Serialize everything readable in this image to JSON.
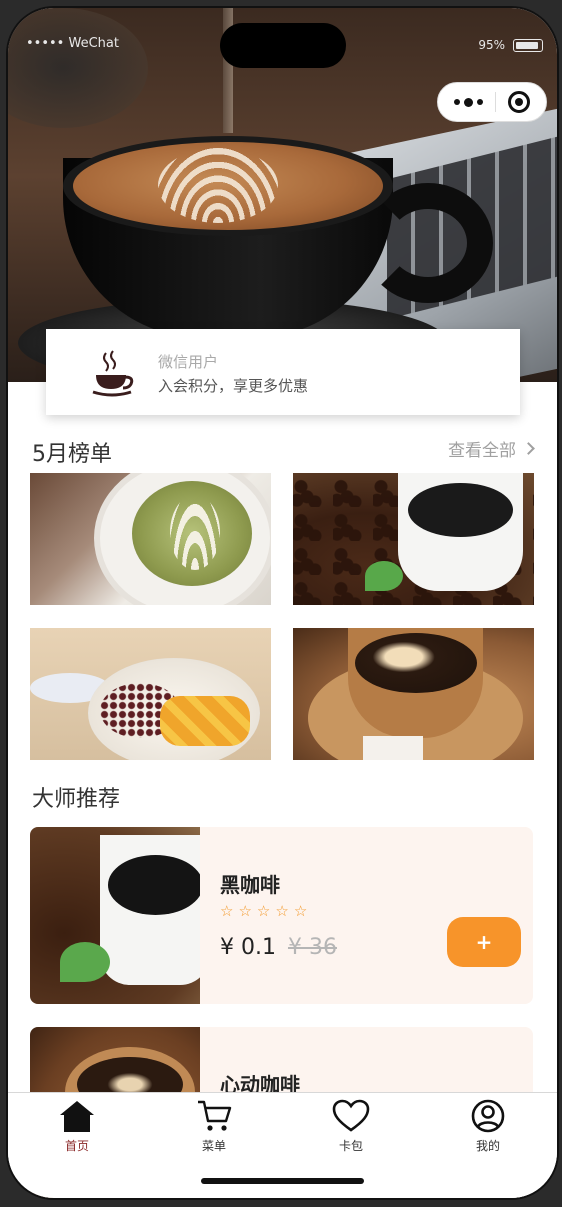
{
  "status_bar": {
    "carrier": "••••• WeChat",
    "battery": "95%"
  },
  "member": {
    "name": "微信用户",
    "desc": "入会积分，享更多优惠"
  },
  "ranking": {
    "title": "5月榜单",
    "see_all": "查看全部"
  },
  "recommend": {
    "title": "大师推荐",
    "items": [
      {
        "name": "黑咖啡",
        "price": "¥ 0.1",
        "old_price": "¥ 36",
        "add": "+",
        "rating": 0
      },
      {
        "name": "心动咖啡"
      }
    ]
  },
  "tabs": [
    {
      "label": "首页",
      "icon": "home-icon",
      "active": true
    },
    {
      "label": "菜单",
      "icon": "cart-icon"
    },
    {
      "label": "卡包",
      "icon": "heart-icon"
    },
    {
      "label": "我的",
      "icon": "user-icon"
    }
  ],
  "colors": {
    "accent": "#f7942a",
    "active_tab": "#8b2a2a",
    "card_bg": "#fdf4ef"
  }
}
